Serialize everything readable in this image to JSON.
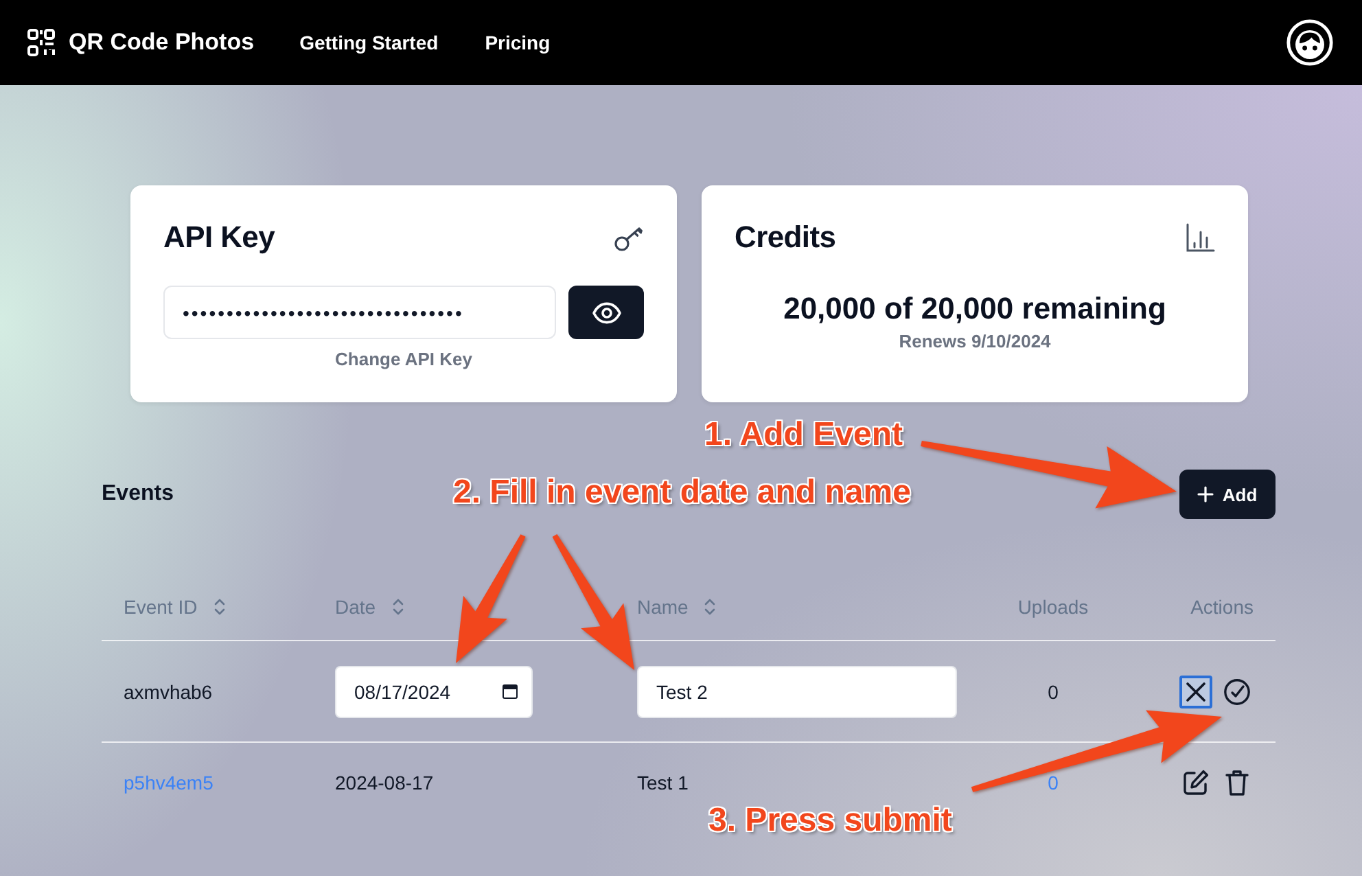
{
  "navbar": {
    "brand": "QR Code Photos",
    "links": [
      {
        "label": "Getting Started"
      },
      {
        "label": "Pricing"
      }
    ]
  },
  "api_key_card": {
    "title": "API Key",
    "value": "••••••••••••••••••••••••••••••••",
    "link": "Change API Key"
  },
  "credits_card": {
    "title": "Credits",
    "summary": "20,000 of 20,000 remaining",
    "renewal": "Renews 9/10/2024"
  },
  "events": {
    "title": "Events",
    "add_button": "Add",
    "columns": [
      {
        "label": "Event ID",
        "sortable": true
      },
      {
        "label": "Date",
        "sortable": true
      },
      {
        "label": "Name",
        "sortable": true
      },
      {
        "label": "Uploads",
        "sortable": false
      },
      {
        "label": "Actions",
        "sortable": false
      }
    ],
    "rows": [
      {
        "kind": "editing",
        "event_id": "axmvhab6",
        "date": "08/17/2024",
        "name": "Test 2",
        "uploads": "0",
        "actions": [
          {
            "kind": "cancel",
            "focused": true
          },
          {
            "kind": "submit",
            "focused": false
          }
        ]
      },
      {
        "kind": "display",
        "event_id": "p5hv4em5",
        "date": "2024-08-17",
        "name": "Test 1",
        "uploads": "0",
        "actions": [
          {
            "kind": "edit",
            "focused": false
          },
          {
            "kind": "delete",
            "focused": false
          }
        ]
      }
    ]
  },
  "annotations": [
    {
      "text": "1. Add Event"
    },
    {
      "text": "2. Fill in event date and name"
    },
    {
      "text": "3. Press submit"
    }
  ]
}
